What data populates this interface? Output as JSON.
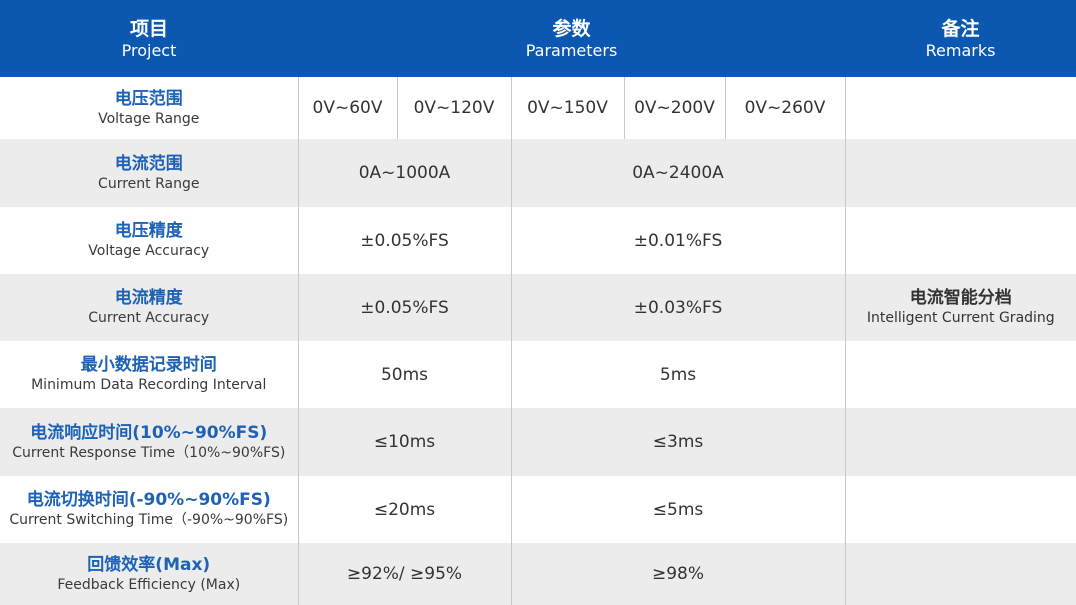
{
  "header": {
    "project_zh": "项目",
    "project_en": "Project",
    "params_zh": "参数",
    "params_en": "Parameters",
    "remarks_zh": "备注",
    "remarks_en": "Remarks"
  },
  "rows": {
    "voltage_range": {
      "label_zh": "电压范围",
      "label_en": "Voltage Range",
      "values": [
        "0V~60V",
        "0V~120V",
        "0V~150V",
        "0V~200V",
        "0V~260V"
      ]
    },
    "current_range": {
      "label_zh": "电流范围",
      "label_en": "Current Range",
      "value_a": "0A~1000A",
      "value_b": "0A~2400A"
    },
    "voltage_accuracy": {
      "label_zh": "电压精度",
      "label_en": "Voltage Accuracy",
      "value_a": "±0.05%FS",
      "value_b": "±0.01%FS"
    },
    "current_accuracy": {
      "label_zh": "电流精度",
      "label_en": "Current Accuracy",
      "value_a": "±0.05%FS",
      "value_b": "±0.03%FS",
      "remark_zh": "电流智能分档",
      "remark_en": "Intelligent Current Grading"
    },
    "min_record_interval": {
      "label_zh": "最小数据记录时间",
      "label_en": "Minimum Data Recording Interval",
      "value_a": "50ms",
      "value_b": "5ms"
    },
    "current_response_time": {
      "label_zh": "电流响应时间(10%~90%FS)",
      "label_en": "Current Response Time（10%~90%FS)",
      "value_a": "≤10ms",
      "value_b": "≤3ms"
    },
    "current_switching_time": {
      "label_zh": "电流切换时间(-90%~90%FS)",
      "label_en": "Current Switching Time（-90%~90%FS)",
      "value_a": "≤20ms",
      "value_b": "≤5ms"
    },
    "feedback_efficiency": {
      "label_zh": "回馈效率(Max)",
      "label_en": "Feedback Efficiency (Max)",
      "value_a": "≥92%/ ≥95%",
      "value_b": "≥98%"
    }
  },
  "colors": {
    "header_bg": "#0c58b1",
    "label_blue": "#1d62b6",
    "row_alt_bg": "#ececec"
  }
}
